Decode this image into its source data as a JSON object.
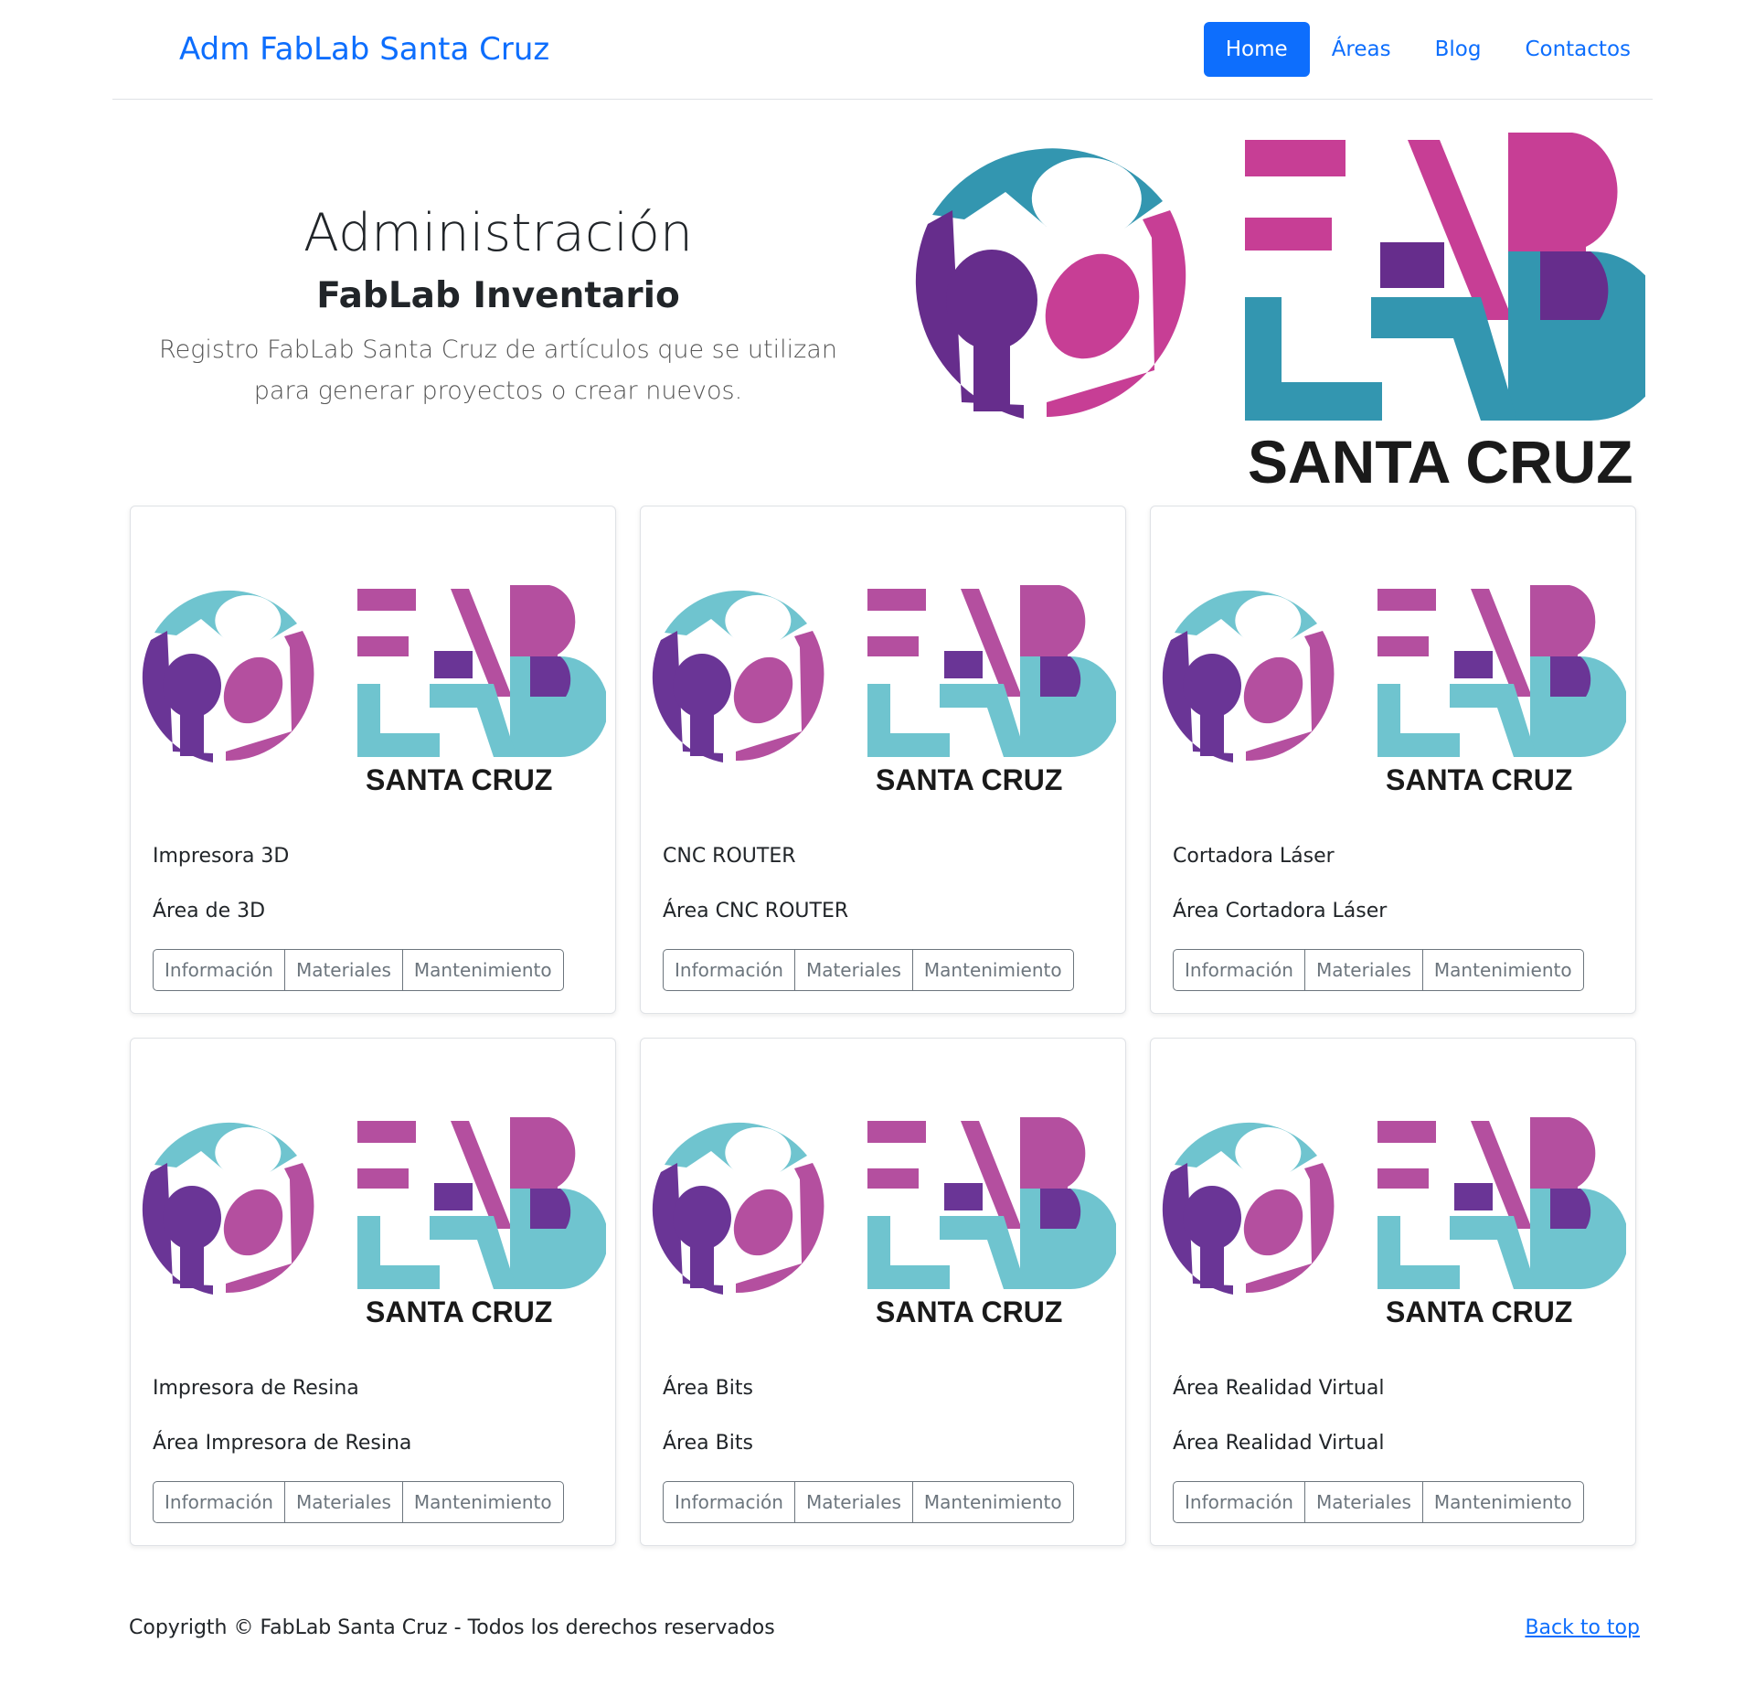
{
  "navbar": {
    "brand": "Adm FabLab Santa Cruz",
    "links": [
      {
        "label": "Home"
      },
      {
        "label": "Áreas"
      },
      {
        "label": "Blog"
      },
      {
        "label": "Contactos"
      }
    ]
  },
  "hero": {
    "title": "Administración",
    "subtitle": "FabLab Inventario",
    "description": "Registro FabLab Santa Cruz de artículos que se utilizan para generar proyectos o crear nuevos.",
    "logo_text": "SANTA CRUZ"
  },
  "cards": [
    {
      "title": "Impresora 3D",
      "text": "Área de 3D",
      "logo_text": "SANTA CRUZ",
      "buttons": [
        "Información",
        "Materiales",
        "Mantenimiento"
      ]
    },
    {
      "title": "CNC ROUTER",
      "text": "Área CNC ROUTER",
      "logo_text": "SANTA CRUZ",
      "buttons": [
        "Información",
        "Materiales",
        "Mantenimiento"
      ]
    },
    {
      "title": "Cortadora Láser",
      "text": "Área Cortadora Láser",
      "logo_text": "SANTA CRUZ",
      "buttons": [
        "Información",
        "Materiales",
        "Mantenimiento"
      ]
    },
    {
      "title": "Impresora de Resina",
      "text": "Área Impresora de Resina",
      "logo_text": "SANTA CRUZ",
      "buttons": [
        "Información",
        "Materiales",
        "Mantenimiento"
      ]
    },
    {
      "title": "Área Bits",
      "text": "Área Bits",
      "logo_text": "SANTA CRUZ",
      "buttons": [
        "Información",
        "Materiales",
        "Mantenimiento"
      ]
    },
    {
      "title": "Área Realidad Virtual",
      "text": "Área Realidad Virtual",
      "logo_text": "SANTA CRUZ",
      "buttons": [
        "Información",
        "Materiales",
        "Mantenimiento"
      ]
    }
  ],
  "footer": {
    "copyright": "Copyrigth © FabLab Santa Cruz - Todos los derechos reservados",
    "back_to_top": "Back to top"
  },
  "colors": {
    "primary": "#0d6efd",
    "logo_teal": "#3396b0",
    "logo_purple": "#662d8c",
    "logo_magenta": "#c73e95",
    "card_teal": "#6fc4cf",
    "card_purple": "#6a3596",
    "card_magenta": "#b44f9f"
  }
}
